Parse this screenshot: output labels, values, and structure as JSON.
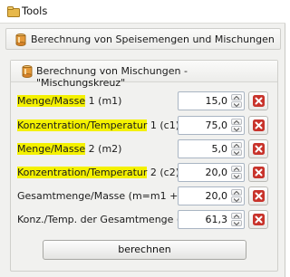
{
  "window": {
    "title": "Tools"
  },
  "panel_outer": {
    "title": "Berechnung von Speisemengen und Mischungen"
  },
  "panel_inner": {
    "title": "Berechnung von Mischungen - \"Mischungskreuz\""
  },
  "rows": [
    {
      "label_hl": "Menge/Masse",
      "label_rest": " 1 (m1)",
      "value": "15,0"
    },
    {
      "label_hl": "Konzentration/Temperatur",
      "label_rest": " 1 (c1)",
      "value": "75,0"
    },
    {
      "label_hl": "Menge/Masse",
      "label_rest": " 2 (m2)",
      "value": "5,0"
    },
    {
      "label_hl": "Konzentration/Temperatur",
      "label_rest": " 2 (c2)",
      "value": "20,0"
    },
    {
      "label_hl": "",
      "label_rest": "Gesamtmenge/Masse (m=m1 + m2)",
      "value": "20,0"
    },
    {
      "label_hl": "",
      "label_rest": "Konz./Temp. der Gesamtmenge (c)",
      "value": "61,3"
    }
  ],
  "calculate_button": {
    "label": "berechnen"
  },
  "colors": {
    "highlight": "#f4f100",
    "delete_icon": "#c8332b"
  },
  "icons": {
    "app": "tools-icon",
    "panel": "container-icon",
    "delete": "delete-icon",
    "spin_up": "arrow-up-icon",
    "spin_down": "arrow-down-icon"
  }
}
